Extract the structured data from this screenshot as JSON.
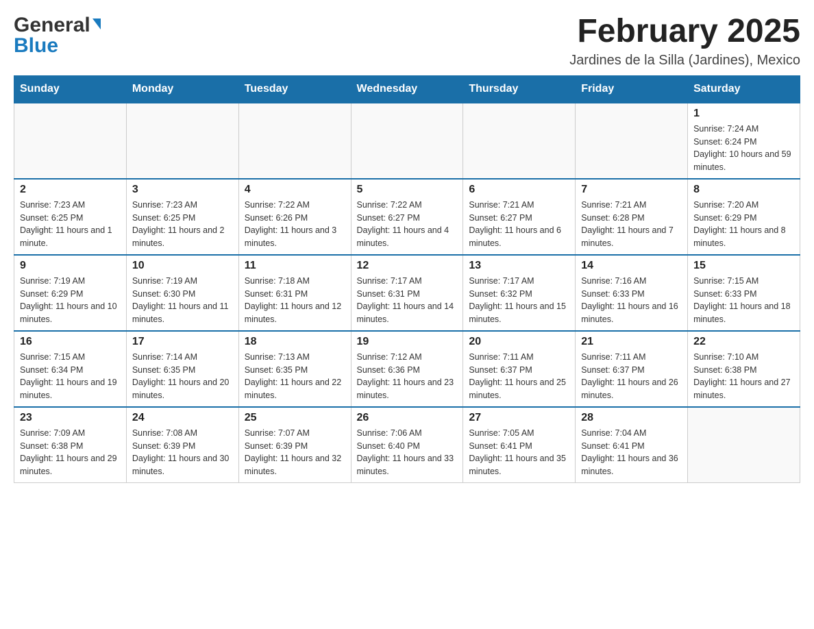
{
  "header": {
    "logo_general": "General",
    "logo_blue": "Blue",
    "month_title": "February 2025",
    "location": "Jardines de la Silla (Jardines), Mexico"
  },
  "days_of_week": [
    "Sunday",
    "Monday",
    "Tuesday",
    "Wednesday",
    "Thursday",
    "Friday",
    "Saturday"
  ],
  "weeks": [
    [
      {
        "day": "",
        "info": ""
      },
      {
        "day": "",
        "info": ""
      },
      {
        "day": "",
        "info": ""
      },
      {
        "day": "",
        "info": ""
      },
      {
        "day": "",
        "info": ""
      },
      {
        "day": "",
        "info": ""
      },
      {
        "day": "1",
        "info": "Sunrise: 7:24 AM\nSunset: 6:24 PM\nDaylight: 10 hours and 59 minutes."
      }
    ],
    [
      {
        "day": "2",
        "info": "Sunrise: 7:23 AM\nSunset: 6:25 PM\nDaylight: 11 hours and 1 minute."
      },
      {
        "day": "3",
        "info": "Sunrise: 7:23 AM\nSunset: 6:25 PM\nDaylight: 11 hours and 2 minutes."
      },
      {
        "day": "4",
        "info": "Sunrise: 7:22 AM\nSunset: 6:26 PM\nDaylight: 11 hours and 3 minutes."
      },
      {
        "day": "5",
        "info": "Sunrise: 7:22 AM\nSunset: 6:27 PM\nDaylight: 11 hours and 4 minutes."
      },
      {
        "day": "6",
        "info": "Sunrise: 7:21 AM\nSunset: 6:27 PM\nDaylight: 11 hours and 6 minutes."
      },
      {
        "day": "7",
        "info": "Sunrise: 7:21 AM\nSunset: 6:28 PM\nDaylight: 11 hours and 7 minutes."
      },
      {
        "day": "8",
        "info": "Sunrise: 7:20 AM\nSunset: 6:29 PM\nDaylight: 11 hours and 8 minutes."
      }
    ],
    [
      {
        "day": "9",
        "info": "Sunrise: 7:19 AM\nSunset: 6:29 PM\nDaylight: 11 hours and 10 minutes."
      },
      {
        "day": "10",
        "info": "Sunrise: 7:19 AM\nSunset: 6:30 PM\nDaylight: 11 hours and 11 minutes."
      },
      {
        "day": "11",
        "info": "Sunrise: 7:18 AM\nSunset: 6:31 PM\nDaylight: 11 hours and 12 minutes."
      },
      {
        "day": "12",
        "info": "Sunrise: 7:17 AM\nSunset: 6:31 PM\nDaylight: 11 hours and 14 minutes."
      },
      {
        "day": "13",
        "info": "Sunrise: 7:17 AM\nSunset: 6:32 PM\nDaylight: 11 hours and 15 minutes."
      },
      {
        "day": "14",
        "info": "Sunrise: 7:16 AM\nSunset: 6:33 PM\nDaylight: 11 hours and 16 minutes."
      },
      {
        "day": "15",
        "info": "Sunrise: 7:15 AM\nSunset: 6:33 PM\nDaylight: 11 hours and 18 minutes."
      }
    ],
    [
      {
        "day": "16",
        "info": "Sunrise: 7:15 AM\nSunset: 6:34 PM\nDaylight: 11 hours and 19 minutes."
      },
      {
        "day": "17",
        "info": "Sunrise: 7:14 AM\nSunset: 6:35 PM\nDaylight: 11 hours and 20 minutes."
      },
      {
        "day": "18",
        "info": "Sunrise: 7:13 AM\nSunset: 6:35 PM\nDaylight: 11 hours and 22 minutes."
      },
      {
        "day": "19",
        "info": "Sunrise: 7:12 AM\nSunset: 6:36 PM\nDaylight: 11 hours and 23 minutes."
      },
      {
        "day": "20",
        "info": "Sunrise: 7:11 AM\nSunset: 6:37 PM\nDaylight: 11 hours and 25 minutes."
      },
      {
        "day": "21",
        "info": "Sunrise: 7:11 AM\nSunset: 6:37 PM\nDaylight: 11 hours and 26 minutes."
      },
      {
        "day": "22",
        "info": "Sunrise: 7:10 AM\nSunset: 6:38 PM\nDaylight: 11 hours and 27 minutes."
      }
    ],
    [
      {
        "day": "23",
        "info": "Sunrise: 7:09 AM\nSunset: 6:38 PM\nDaylight: 11 hours and 29 minutes."
      },
      {
        "day": "24",
        "info": "Sunrise: 7:08 AM\nSunset: 6:39 PM\nDaylight: 11 hours and 30 minutes."
      },
      {
        "day": "25",
        "info": "Sunrise: 7:07 AM\nSunset: 6:39 PM\nDaylight: 11 hours and 32 minutes."
      },
      {
        "day": "26",
        "info": "Sunrise: 7:06 AM\nSunset: 6:40 PM\nDaylight: 11 hours and 33 minutes."
      },
      {
        "day": "27",
        "info": "Sunrise: 7:05 AM\nSunset: 6:41 PM\nDaylight: 11 hours and 35 minutes."
      },
      {
        "day": "28",
        "info": "Sunrise: 7:04 AM\nSunset: 6:41 PM\nDaylight: 11 hours and 36 minutes."
      },
      {
        "day": "",
        "info": ""
      }
    ]
  ]
}
